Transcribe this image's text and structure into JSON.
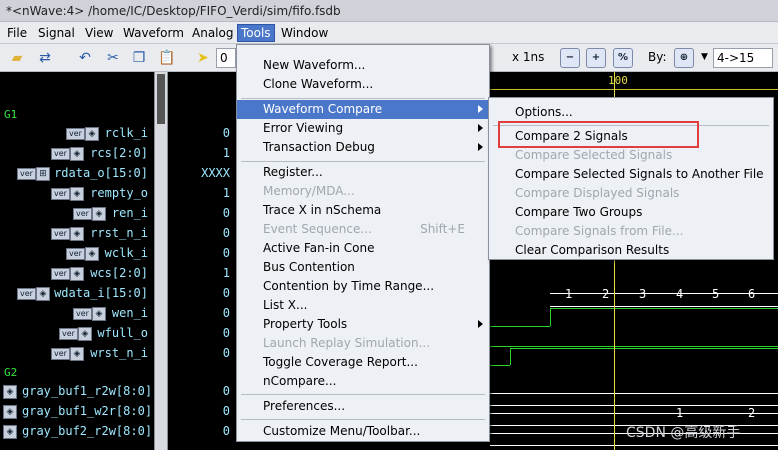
{
  "window": {
    "title": "*<nWave:4> /home/IC/Desktop/FIFO_Verdi/sim/fifo.fsdb"
  },
  "menubar": {
    "items": [
      "File",
      "Signal",
      "View",
      "Waveform",
      "Analog",
      "Tools",
      "Window"
    ],
    "active": "Tools"
  },
  "toolbar": {
    "cursor_time": "0",
    "time_unit": "x 1ns",
    "by_label": "By:",
    "range_select": "4->15",
    "zoom_percent_label": "%"
  },
  "ruler": {
    "labels": [
      "100"
    ]
  },
  "groups": [
    "G1",
    "G2"
  ],
  "signals": [
    {
      "name": "rclk_i",
      "value": "0"
    },
    {
      "name": "rcs[2:0]",
      "value": "1"
    },
    {
      "name": "rdata_o[15:0]",
      "value": "XXXX"
    },
    {
      "name": "rempty_o",
      "value": "1"
    },
    {
      "name": "ren_i",
      "value": "0"
    },
    {
      "name": "rrst_n_i",
      "value": "0"
    },
    {
      "name": "wclk_i",
      "value": "0"
    },
    {
      "name": "wcs[2:0]",
      "value": "1"
    },
    {
      "name": "wdata_i[15:0]",
      "value": "0"
    },
    {
      "name": "wen_i",
      "value": "0"
    },
    {
      "name": "wfull_o",
      "value": "0"
    },
    {
      "name": "wrst_n_i",
      "value": "0"
    }
  ],
  "signals_g2": [
    {
      "name": "gray_buf1_r2w[8:0]",
      "value": "0"
    },
    {
      "name": "gray_buf1_w2r[8:0]",
      "value": "0"
    },
    {
      "name": "gray_buf2_r2w[8:0]",
      "value": "0"
    }
  ],
  "wave_labels": {
    "wdata_i": [
      "1",
      "2",
      "3",
      "4",
      "5",
      "6"
    ],
    "gray_buf1_w2r": [
      "1",
      "2"
    ]
  },
  "tools_menu": {
    "items": [
      {
        "label": "New Waveform...",
        "enabled": true
      },
      {
        "label": "Clone Waveform...",
        "enabled": true
      },
      {
        "label": "Waveform Compare",
        "enabled": true,
        "submenu": true,
        "highlighted": true
      },
      {
        "label": "Error Viewing",
        "enabled": true,
        "submenu": true
      },
      {
        "label": "Transaction Debug",
        "enabled": true,
        "submenu": true
      },
      {
        "label": "Register...",
        "enabled": true
      },
      {
        "label": "Memory/MDA...",
        "enabled": false
      },
      {
        "label": "Trace X in nSchema",
        "enabled": true
      },
      {
        "label": "Event Sequence...",
        "enabled": false,
        "shortcut": "Shift+E"
      },
      {
        "label": "Active Fan-in Cone",
        "enabled": true
      },
      {
        "label": "Bus Contention",
        "enabled": true
      },
      {
        "label": "Contention by Time Range...",
        "enabled": true
      },
      {
        "label": "List X...",
        "enabled": true
      },
      {
        "label": "Property Tools",
        "enabled": true,
        "submenu": true
      },
      {
        "label": "Launch Replay Simulation...",
        "enabled": false
      },
      {
        "label": "Toggle Coverage Report...",
        "enabled": true
      },
      {
        "label": "nCompare...",
        "enabled": true
      },
      {
        "label": "Preferences...",
        "enabled": true
      },
      {
        "label": "Customize Menu/Toolbar...",
        "enabled": true
      }
    ]
  },
  "compare_submenu": {
    "items": [
      {
        "label": "Options...",
        "enabled": true
      },
      {
        "label": "Compare 2 Signals",
        "enabled": true,
        "boxed": true
      },
      {
        "label": "Compare Selected Signals",
        "enabled": false
      },
      {
        "label": "Compare Selected Signals to Another File",
        "enabled": true
      },
      {
        "label": "Compare Displayed Signals",
        "enabled": false
      },
      {
        "label": "Compare Two Groups",
        "enabled": true
      },
      {
        "label": "Compare Signals from File...",
        "enabled": false
      },
      {
        "label": "Clear Comparison Results",
        "enabled": true
      }
    ]
  },
  "watermark": "CSDN @高级新手",
  "colors": {
    "accent": "#4a77c9",
    "signal_text": "#9fe8ff",
    "group_text": "#35e53a",
    "wave": "#2bd32b",
    "cursor": "#e6dc4a",
    "highlight_box": "#e23d3d"
  }
}
